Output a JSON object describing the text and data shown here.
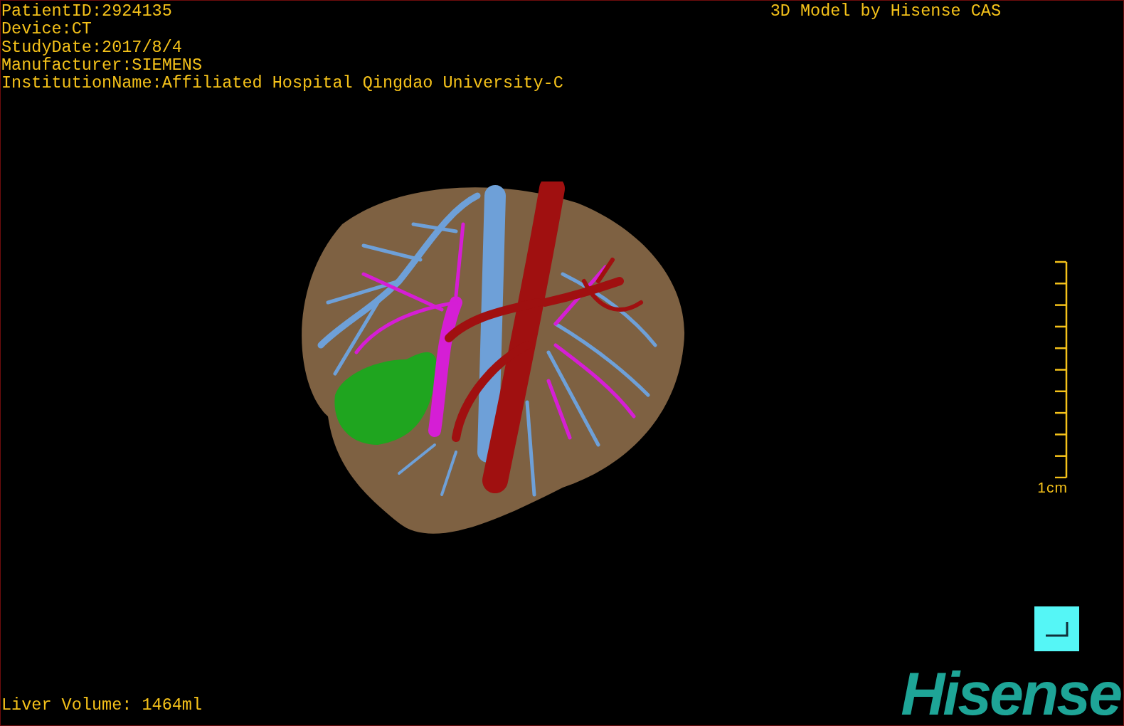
{
  "viewer": {
    "info_lines": [
      "PatientID:2924135",
      "Device:CT",
      "StudyDate:2017/8/4",
      "Manufacturer:SIEMENS",
      "InstitutionName:Affiliated Hospital Qingdao University-C"
    ],
    "title": "3D Model by Hisense CAS",
    "scale_bar": {
      "label": "1cm"
    },
    "liver_volume": "Liver Volume: 1464ml",
    "logo": "Hisense"
  }
}
